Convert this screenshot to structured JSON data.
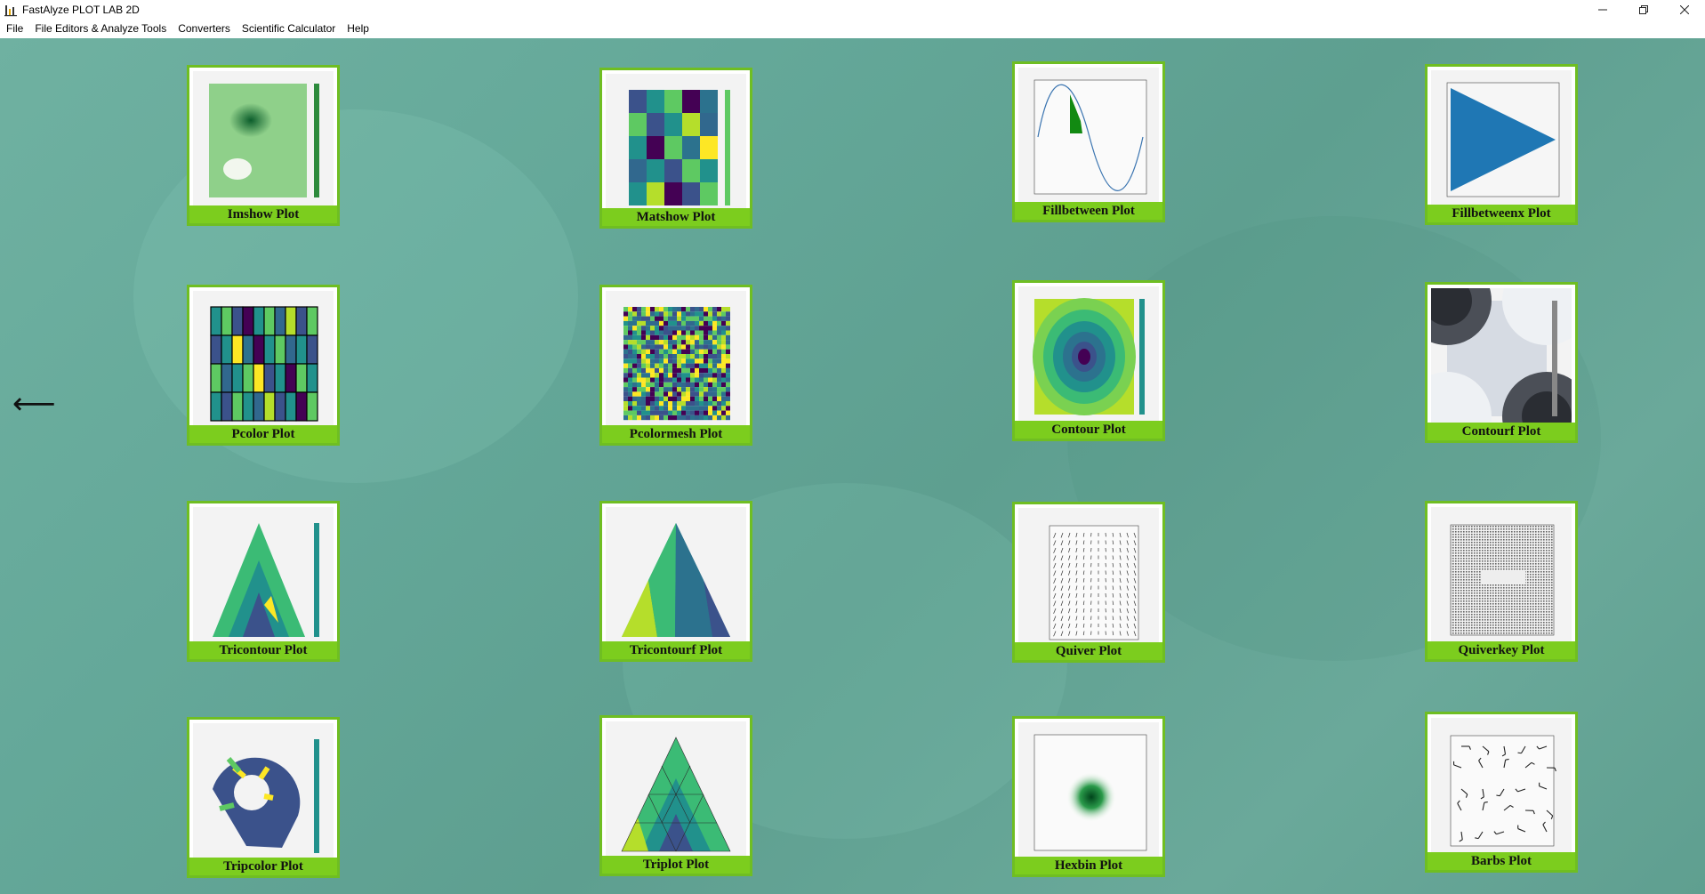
{
  "window": {
    "title": "FastAlyze PLOT LAB 2D",
    "controls": [
      "minimize-icon",
      "restore-icon",
      "close-icon"
    ]
  },
  "menu": {
    "items": [
      "File",
      "File Editors & Analyze Tools",
      "Converters",
      "Scientific Calculator",
      "Help"
    ]
  },
  "nav": {
    "back_icon": "left-arrow-icon",
    "back_glyph": "⟵"
  },
  "colors": {
    "card_border": "#6fbe22",
    "label_bg": "#7ccd1e",
    "background": "#64a899"
  },
  "plots": [
    {
      "label": "Imshow Plot",
      "icon": "imshow-thumbnail"
    },
    {
      "label": "Matshow Plot",
      "icon": "matshow-thumbnail"
    },
    {
      "label": "Fillbetween Plot",
      "icon": "fillbetween-thumbnail"
    },
    {
      "label": "Fillbetweenx Plot",
      "icon": "fillbetweenx-thumbnail"
    },
    {
      "label": "Pcolor Plot",
      "icon": "pcolor-thumbnail"
    },
    {
      "label": "Pcolormesh Plot",
      "icon": "pcolormesh-thumbnail"
    },
    {
      "label": "Contour Plot",
      "icon": "contour-thumbnail"
    },
    {
      "label": "Contourf Plot",
      "icon": "contourf-thumbnail"
    },
    {
      "label": "Tricontour Plot",
      "icon": "tricontour-thumbnail"
    },
    {
      "label": "Tricontourf Plot",
      "icon": "tricontourf-thumbnail"
    },
    {
      "label": "Quiver Plot",
      "icon": "quiver-thumbnail"
    },
    {
      "label": "Quiverkey Plot",
      "icon": "quiverkey-thumbnail"
    },
    {
      "label": "Tripcolor Plot",
      "icon": "tripcolor-thumbnail"
    },
    {
      "label": "Triplot Plot",
      "icon": "triplot-thumbnail"
    },
    {
      "label": "Hexbin Plot",
      "icon": "hexbin-thumbnail"
    },
    {
      "label": "Barbs Plot",
      "icon": "barbs-thumbnail"
    }
  ]
}
